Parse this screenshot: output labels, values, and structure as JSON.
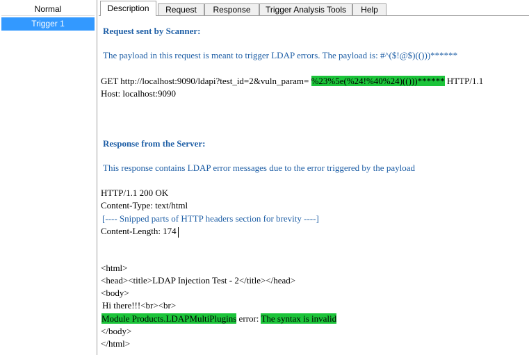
{
  "triggers": {
    "items": [
      {
        "label": "Normal",
        "selected": false
      },
      {
        "label": "Trigger 1",
        "selected": true
      }
    ],
    "selected_color": "#3399ff"
  },
  "tabs": [
    "Description",
    "Request",
    "Response",
    "Trigger Analysis Tools",
    "Help"
  ],
  "active_tab": "Description",
  "description": {
    "request_heading": "Request sent by Scanner:",
    "request_summary": "The payload in this request is meant to trigger LDAP errors. The payload is: #^($!@$)(()))******",
    "request_line_pre": "GET http://localhost:9090/ldapi?test_id=2&vuln_param=",
    "request_line_payload": "%23%5e(%24!%40%24)(()))******",
    "request_line_post": "HTTP/1.1",
    "host_line": "Host: localhost:9090",
    "response_heading": "Response from the Server:",
    "response_summary": "This response contains LDAP error messages due to the error triggered by the payload",
    "status_line": "HTTP/1.1 200 OK",
    "content_type_line": "Content-Type: text/html",
    "snipped_note": "[---- Snipped parts of HTTP headers section for brevity ----]",
    "content_length_line": "Content-Length: 174",
    "body": {
      "html_open": "<html>",
      "head_line": "<head><title>LDAP Injection Test - 2</title></head>",
      "body_open": "<body>",
      "greeting": "Hi there!!!<br><br>",
      "error_module": "Module Products.LDAPMultiPlugins",
      "error_word": "error:",
      "error_message": "The syntax is invalid",
      "body_close": "</body>",
      "html_close": "</html>"
    },
    "highlight_color": "#1cc43a",
    "heading_color": "#1f5fa6"
  }
}
